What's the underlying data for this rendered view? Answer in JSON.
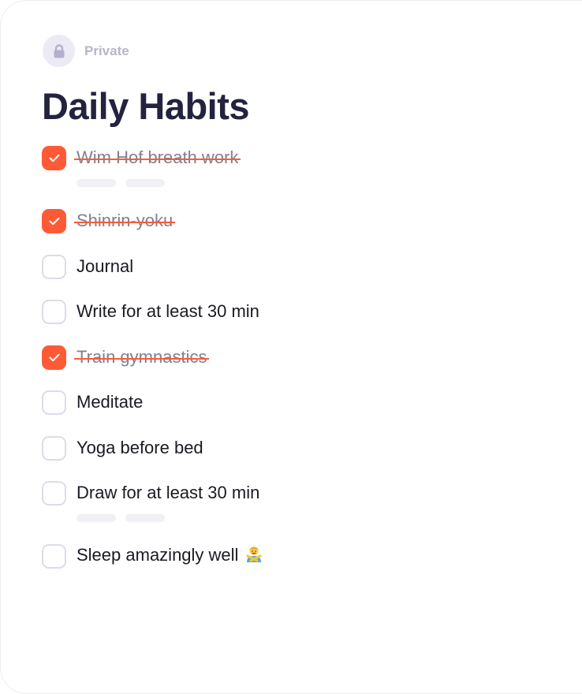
{
  "privacy": {
    "icon": "lock-icon",
    "label": "Private"
  },
  "page": {
    "title": "Daily Habits"
  },
  "colors": {
    "accent": "#ff5a36",
    "title": "#232340",
    "muted": "#b8b5cc"
  },
  "habits": [
    {
      "label": "Wim Hof breath work",
      "checked": true
    },
    {
      "label": "Shinrin-yoku",
      "checked": true
    },
    {
      "label": "Journal",
      "checked": false
    },
    {
      "label": "Write for at least 30 min",
      "checked": false
    },
    {
      "label": "Train gymnastics",
      "checked": true
    },
    {
      "label": "Meditate",
      "checked": false
    },
    {
      "label": "Yoga before bed",
      "checked": false
    },
    {
      "label": "Draw for at least 30 min",
      "checked": false
    },
    {
      "label": "Sleep amazingly well",
      "checked": false,
      "icon": "person-gesturing-no-emoji-icon"
    }
  ]
}
